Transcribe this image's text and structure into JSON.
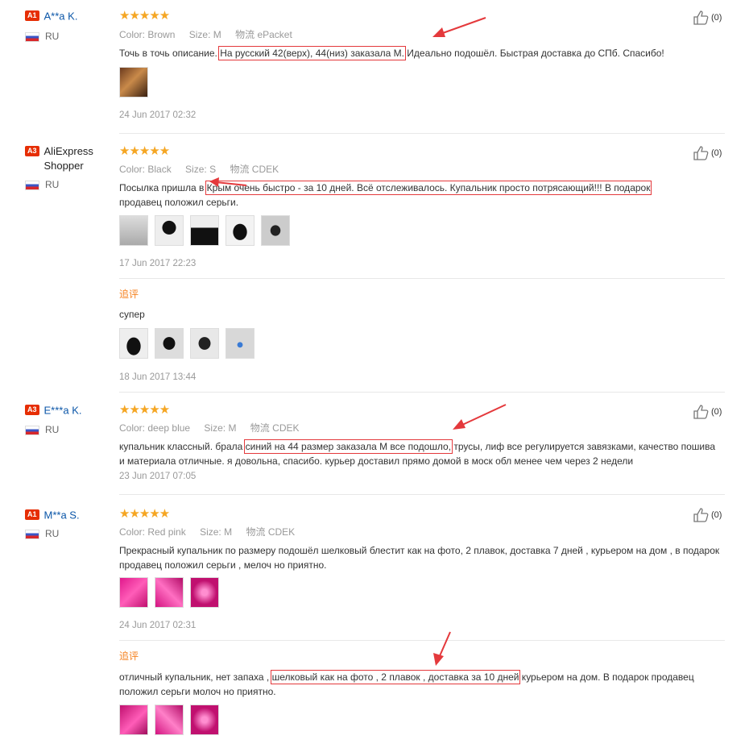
{
  "common": {
    "color_label": "Color:",
    "size_label": "Size:",
    "logistics_label": "物流",
    "followup_label": "追评",
    "stars": "★★★★★",
    "thumb_icon": "thumbs-up-icon"
  },
  "reviews": [
    {
      "level": "A1",
      "name": "A**a K.",
      "country": "RU",
      "color": "Brown",
      "size": "M",
      "logistics": "ePacket",
      "text_before": "Точь в точь описание. ",
      "text_hl": "На русский 42(верх), 44(низ) заказала М.",
      "text_after": " Идеально подошёл. Быстрая доставка до СПб. Спасибо!",
      "date": "24 Jun 2017 02:32",
      "likes": "(0)"
    },
    {
      "level": "A3",
      "name": "AliExpress Shopper",
      "country": "RU",
      "color": "Black",
      "size": "S",
      "logistics": "CDEK",
      "text_before": "Посылка пришла в ",
      "text_hl": "Крым очень быстро - за 10 дней. Всё отслеживалось. Купальник просто потрясающий!!! В подарок",
      "text_after": " продавец положил серьги.",
      "date": "17 Jun 2017 22:23",
      "likes": "(0)",
      "followup_text": "супер",
      "followup_date": "18 Jun 2017 13:44"
    },
    {
      "level": "A3",
      "name": "E***a K.",
      "country": "RU",
      "color": "deep blue",
      "size": "M",
      "logistics": "CDEK",
      "text_before": "купальник классный. брала ",
      "text_hl": "синий на 44 размер заказала М все подошло,",
      "text_after": " трусы, лиф все регулируется завязками, качество пошива и материала отличные. я довольна, спасибо. курьер доставил прямо домой в моск обл менее чем через 2 недели",
      "date": "23 Jun 2017 07:05",
      "likes": "(0)"
    },
    {
      "level": "A1",
      "name": "M**a S.",
      "country": "RU",
      "color": "Red pink",
      "size": "M",
      "logistics": "CDEK",
      "text": "Прекрасный купальник по размеру подошёл шелковый блестит как на фото, 2 плавок, доставка 7 дней , курьером на дом , в подарок продавец положил серьги , мелоч но приятно.",
      "date": "24 Jun 2017 02:31",
      "likes": "(0)",
      "followup_before": "отличный купальник, нет запаха , ",
      "followup_hl": "шелковый как на фото , 2 плавок , доставка за 10 дней",
      "followup_after": " курьером на дом. В подарок продавец положил серьги молоч но приятно."
    }
  ]
}
